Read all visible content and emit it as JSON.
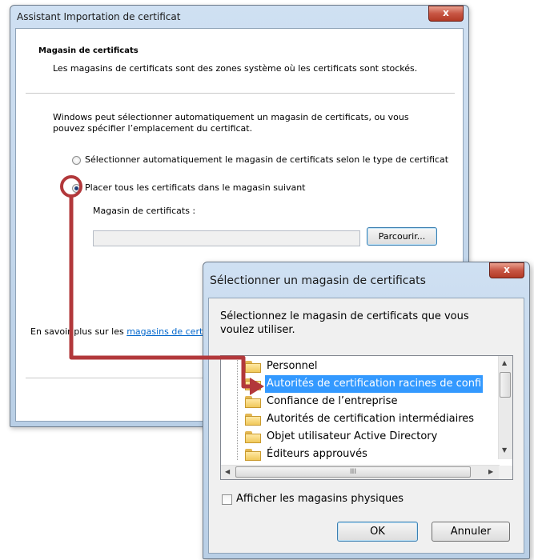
{
  "wizard": {
    "title": "Assistant Importation de certificat",
    "close_glyph": "x",
    "header_title": "Magasin de certificats",
    "header_desc": "Les magasins de certificats sont des zones système où les certificats sont stockés.",
    "intro": "Windows peut sélectionner automatiquement un magasin de certificats, ou vous pouvez spécifier l’emplacement du certificat.",
    "radio_auto_label": "Sélectionner automatiquement le magasin de certificats selon le type de certificat",
    "radio_manual_label": "Placer tous les certificats dans le magasin suivant",
    "store_label": "Magasin de certificats :",
    "store_value": "",
    "browse_button": "Parcourir...",
    "learn_more_prefix": "En savoir plus sur les ",
    "learn_more_link": "magasins de cert"
  },
  "store_dialog": {
    "title": "Sélectionner un magasin de certificats",
    "close_glyph": "x",
    "prompt": "Sélectionnez le magasin de certificats que vous voulez utiliser.",
    "stores": [
      "Personnel",
      "Autorités de certification racines de confi",
      "Confiance de l’entreprise",
      "Autorités de certification intermédiaires",
      "Objet utilisateur Active Directory",
      "Éditeurs approuvés"
    ],
    "selected_store": "Autorités de certification racines de confi",
    "show_physical_label": "Afficher les magasins physiques",
    "show_physical_checked": false,
    "ok_button": "OK",
    "cancel_button": "Annuler",
    "scroll_grip": "III"
  },
  "colors": {
    "annotation": "#b2383b",
    "selection": "#3399ff",
    "link": "#0066cc"
  }
}
